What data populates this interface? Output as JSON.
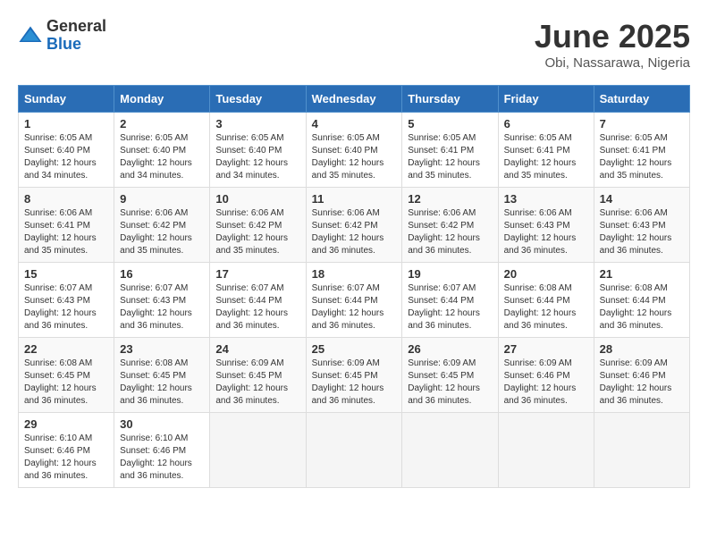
{
  "header": {
    "logo_general": "General",
    "logo_blue": "Blue",
    "month_title": "June 2025",
    "location": "Obi, Nassarawa, Nigeria"
  },
  "days_of_week": [
    "Sunday",
    "Monday",
    "Tuesday",
    "Wednesday",
    "Thursday",
    "Friday",
    "Saturday"
  ],
  "weeks": [
    [
      {
        "day": "1",
        "sunrise": "6:05 AM",
        "sunset": "6:40 PM",
        "daylight": "12 hours and 34 minutes."
      },
      {
        "day": "2",
        "sunrise": "6:05 AM",
        "sunset": "6:40 PM",
        "daylight": "12 hours and 34 minutes."
      },
      {
        "day": "3",
        "sunrise": "6:05 AM",
        "sunset": "6:40 PM",
        "daylight": "12 hours and 34 minutes."
      },
      {
        "day": "4",
        "sunrise": "6:05 AM",
        "sunset": "6:40 PM",
        "daylight": "12 hours and 35 minutes."
      },
      {
        "day": "5",
        "sunrise": "6:05 AM",
        "sunset": "6:41 PM",
        "daylight": "12 hours and 35 minutes."
      },
      {
        "day": "6",
        "sunrise": "6:05 AM",
        "sunset": "6:41 PM",
        "daylight": "12 hours and 35 minutes."
      },
      {
        "day": "7",
        "sunrise": "6:05 AM",
        "sunset": "6:41 PM",
        "daylight": "12 hours and 35 minutes."
      }
    ],
    [
      {
        "day": "8",
        "sunrise": "6:06 AM",
        "sunset": "6:41 PM",
        "daylight": "12 hours and 35 minutes."
      },
      {
        "day": "9",
        "sunrise": "6:06 AM",
        "sunset": "6:42 PM",
        "daylight": "12 hours and 35 minutes."
      },
      {
        "day": "10",
        "sunrise": "6:06 AM",
        "sunset": "6:42 PM",
        "daylight": "12 hours and 35 minutes."
      },
      {
        "day": "11",
        "sunrise": "6:06 AM",
        "sunset": "6:42 PM",
        "daylight": "12 hours and 36 minutes."
      },
      {
        "day": "12",
        "sunrise": "6:06 AM",
        "sunset": "6:42 PM",
        "daylight": "12 hours and 36 minutes."
      },
      {
        "day": "13",
        "sunrise": "6:06 AM",
        "sunset": "6:43 PM",
        "daylight": "12 hours and 36 minutes."
      },
      {
        "day": "14",
        "sunrise": "6:06 AM",
        "sunset": "6:43 PM",
        "daylight": "12 hours and 36 minutes."
      }
    ],
    [
      {
        "day": "15",
        "sunrise": "6:07 AM",
        "sunset": "6:43 PM",
        "daylight": "12 hours and 36 minutes."
      },
      {
        "day": "16",
        "sunrise": "6:07 AM",
        "sunset": "6:43 PM",
        "daylight": "12 hours and 36 minutes."
      },
      {
        "day": "17",
        "sunrise": "6:07 AM",
        "sunset": "6:44 PM",
        "daylight": "12 hours and 36 minutes."
      },
      {
        "day": "18",
        "sunrise": "6:07 AM",
        "sunset": "6:44 PM",
        "daylight": "12 hours and 36 minutes."
      },
      {
        "day": "19",
        "sunrise": "6:07 AM",
        "sunset": "6:44 PM",
        "daylight": "12 hours and 36 minutes."
      },
      {
        "day": "20",
        "sunrise": "6:08 AM",
        "sunset": "6:44 PM",
        "daylight": "12 hours and 36 minutes."
      },
      {
        "day": "21",
        "sunrise": "6:08 AM",
        "sunset": "6:44 PM",
        "daylight": "12 hours and 36 minutes."
      }
    ],
    [
      {
        "day": "22",
        "sunrise": "6:08 AM",
        "sunset": "6:45 PM",
        "daylight": "12 hours and 36 minutes."
      },
      {
        "day": "23",
        "sunrise": "6:08 AM",
        "sunset": "6:45 PM",
        "daylight": "12 hours and 36 minutes."
      },
      {
        "day": "24",
        "sunrise": "6:09 AM",
        "sunset": "6:45 PM",
        "daylight": "12 hours and 36 minutes."
      },
      {
        "day": "25",
        "sunrise": "6:09 AM",
        "sunset": "6:45 PM",
        "daylight": "12 hours and 36 minutes."
      },
      {
        "day": "26",
        "sunrise": "6:09 AM",
        "sunset": "6:45 PM",
        "daylight": "12 hours and 36 minutes."
      },
      {
        "day": "27",
        "sunrise": "6:09 AM",
        "sunset": "6:46 PM",
        "daylight": "12 hours and 36 minutes."
      },
      {
        "day": "28",
        "sunrise": "6:09 AM",
        "sunset": "6:46 PM",
        "daylight": "12 hours and 36 minutes."
      }
    ],
    [
      {
        "day": "29",
        "sunrise": "6:10 AM",
        "sunset": "6:46 PM",
        "daylight": "12 hours and 36 minutes."
      },
      {
        "day": "30",
        "sunrise": "6:10 AM",
        "sunset": "6:46 PM",
        "daylight": "12 hours and 36 minutes."
      },
      null,
      null,
      null,
      null,
      null
    ]
  ],
  "labels": {
    "sunrise": "Sunrise:",
    "sunset": "Sunset:",
    "daylight": "Daylight:"
  }
}
